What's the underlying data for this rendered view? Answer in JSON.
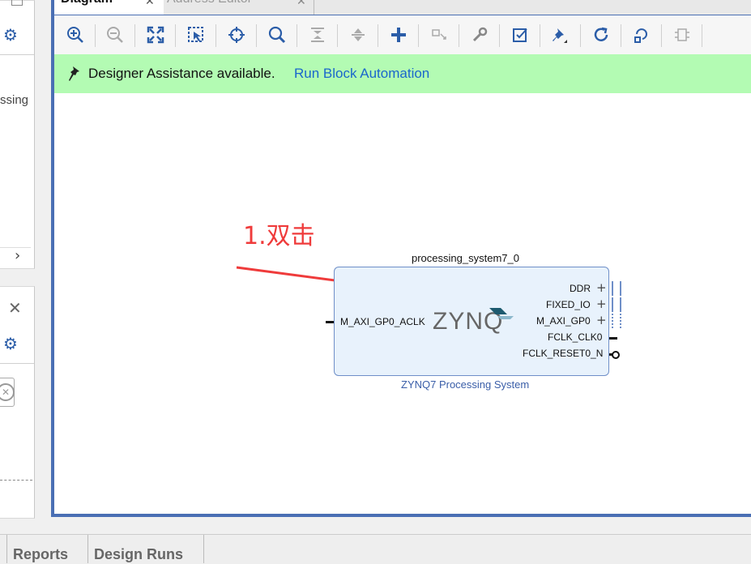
{
  "tabs": {
    "diagram": "Diagram",
    "address_editor": "Address Editor"
  },
  "left_panel": {
    "partial_text": "ssing"
  },
  "banner": {
    "message": "Designer Assistance available.",
    "link": "Run Block Automation"
  },
  "annotation": {
    "text": "1.双击",
    "color": "#ef3b3b"
  },
  "block": {
    "instance_name": "processing_system7_0",
    "subtitle": "ZYNQ7 Processing System",
    "logo": "ZYNQ",
    "left_ports": [
      "M_AXI_GP0_ACLK"
    ],
    "right_ports": [
      "DDR",
      "FIXED_IO",
      "M_AXI_GP0",
      "FCLK_CLK0",
      "FCLK_RESET0_N"
    ]
  },
  "bottom_tabs": [
    "Reports",
    "Design Runs"
  ],
  "toolbar_icons": [
    "zoom-in-icon",
    "zoom-out-icon",
    "fit-icon",
    "zoom-selection-icon",
    "target-icon",
    "search-icon",
    "collapse-icon",
    "expand-icon",
    "add-ip-icon",
    "make-external-icon",
    "wrench-icon",
    "validate-icon",
    "pin-icon",
    "refresh-icon",
    "regenerate-icon",
    "optimize-icon"
  ],
  "colors": {
    "banner_bg": "#b3fbb3",
    "link": "#1a66cc",
    "frame_border": "#4a6fb4",
    "block_fill": "#e8f2fc",
    "block_border": "#6f8fc8"
  }
}
